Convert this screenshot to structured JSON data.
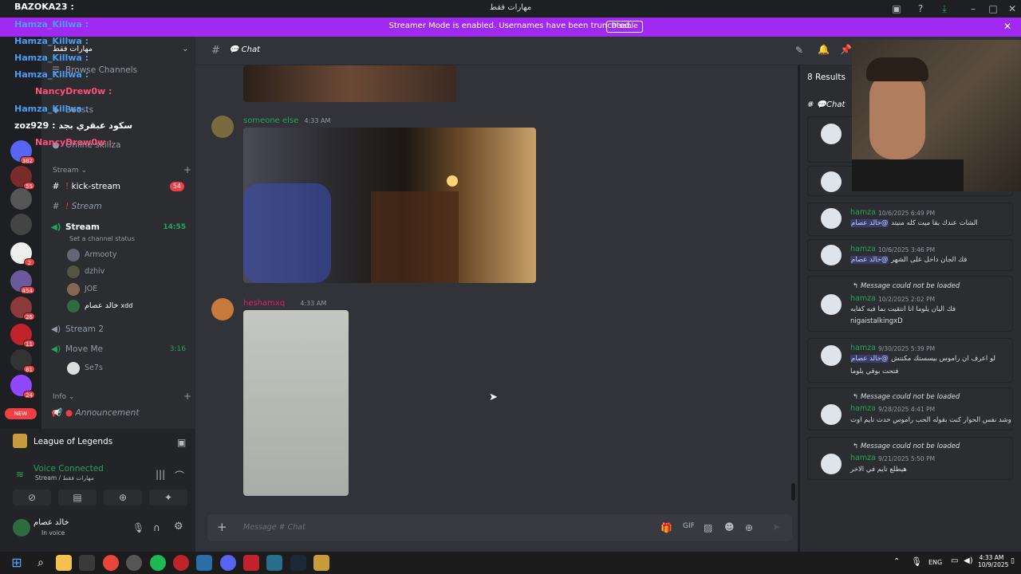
{
  "titlebar": {
    "title": "مهارات فقط",
    "streamer": "BAZOKA23 :"
  },
  "banner": {
    "text": "Streamer Mode is enabled. Usernames have been truncated.",
    "button": "Disable"
  },
  "overlay_chat": [
    {
      "user": "Hamza_Killwa :",
      "color": "#4b9cf5"
    },
    {
      "user": "Hamza_Killwa :",
      "color": "#4b9cf5"
    },
    {
      "user": "Hamza_Killwa :",
      "color": "#4b9cf5"
    },
    {
      "user": "Hamza_Killwa :",
      "color": "#4b9cf5"
    },
    {
      "user": "NancyDrew0w :",
      "color": "#ff4f7a"
    },
    {
      "user": "Hamza_Killwa :",
      "color": "#4b9cf5"
    },
    {
      "user": "zoz929 : سكود عبقري بجد",
      "color": "#ffffff"
    },
    {
      "user": "NancyDrew0w :",
      "color": "#ff4f7a"
    }
  ],
  "server_badges": [
    "382",
    "55",
    "2",
    "454",
    "26",
    "11",
    "81",
    "24",
    "NEW"
  ],
  "sidebar": {
    "server_name": "مهارات فقط",
    "browse": "Browse Channels",
    "boosts": "Boosts",
    "online": "Online",
    "online_user": "skillza",
    "cat_stream": "Stream",
    "cat_info": "Info",
    "ch_kick": "kick-stream",
    "ch_kick_badge": "54",
    "ch_stream_text": "Stream",
    "ch_stream_voice": "Stream",
    "ch_stream_time": "14:55",
    "ch_status": "Set a channel status",
    "voice_users": [
      "Armooty",
      "dzhiv",
      "JOE",
      "خالد عصام"
    ],
    "voice_tag": "xdd",
    "ch_stream2": "Stream 2",
    "ch_moveme": "Move Me",
    "ch_moveme_time": "3:16",
    "moveme_user": "Se7s",
    "ch_announcement": "Announcement"
  },
  "panel": {
    "activity": "League of Legends",
    "voice_status": "Voice Connected",
    "voice_channel": "Stream / مهارات فقط",
    "username": "خالد عصام",
    "user_status": "In voice"
  },
  "chat": {
    "channel": "Chat",
    "messages": [
      {
        "author": "someone else",
        "time": "4:33 AM",
        "color": "#23a559"
      },
      {
        "author": "heshamxq",
        "time": "4:33 AM",
        "color": "#e91e63"
      }
    ],
    "placeholder": "Message # Chat"
  },
  "results": {
    "count": "8 Results",
    "channel": "Chat",
    "items": [
      {
        "name": "hamza",
        "date": "10/6/2025 6:49 PM",
        "mention": "@خالد عصام",
        "text": "الشات عندك بقا ميت كله منيتد",
        "reply": ""
      },
      {
        "name": "hamza",
        "date": "10/6/2025 3:46 PM",
        "mention": "@خالد عصام",
        "text": "فك الجان داخل على الشهر",
        "reply": ""
      },
      {
        "name": "hamza",
        "date": "10/2/2025 2:02 PM",
        "mention": "",
        "text": "فك اليان يلوما انا انتقيت بما فيه كفايه",
        "text2": "nigaistalkingxD",
        "reply": "Message could not be loaded"
      },
      {
        "name": "hamza",
        "date": "9/30/2025 5:39 PM",
        "mention": "@خالد عصام",
        "text": "لو اعرف ان راموس بيسستك مكنتش",
        "text2": "فتحت بوقي يلوما",
        "reply": ""
      },
      {
        "name": "hamza",
        "date": "9/28/2025 4:41 PM",
        "mention": "",
        "text": "وشد نفس الحوار كنت بقوله الحب راموس خدت تايم اوت",
        "reply": "Message could not be loaded"
      },
      {
        "name": "hamza",
        "date": "9/21/2025 5:50 PM",
        "mention": "",
        "text": "هيطلع تايم في الاخر",
        "reply": "Message could not be loaded"
      }
    ]
  },
  "taskbar": {
    "lang": "ENG",
    "time": "4:33 AM",
    "date": "10/9/2025"
  }
}
